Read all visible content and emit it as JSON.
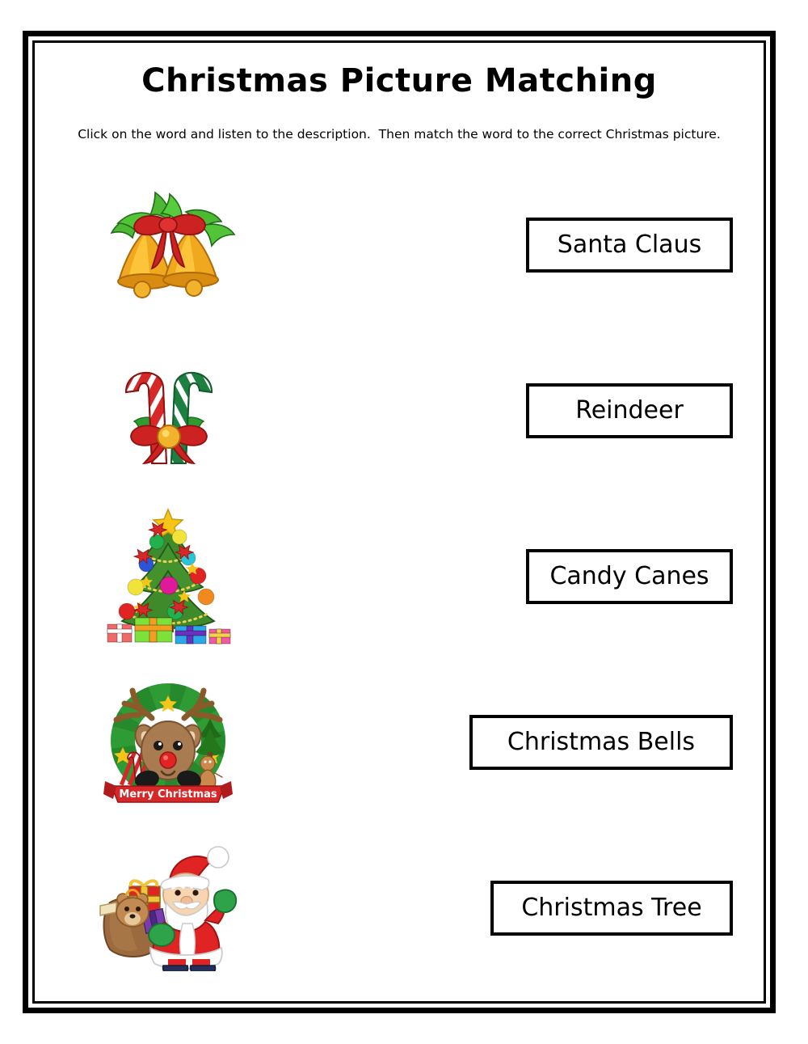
{
  "worksheet": {
    "title": "Christmas Picture Matching",
    "instructions": "Click on the word and listen to the description.  Then match the word to the correct Christmas picture."
  },
  "pictures": [
    {
      "name": "christmas-bells",
      "alt": "Two golden bells tied with a red bow and green holly leaves"
    },
    {
      "name": "candy-canes",
      "alt": "Crossed red-white and green-white candy canes with a red bow and gold bell"
    },
    {
      "name": "christmas-tree",
      "alt": "Decorated green Christmas tree with gold star, ornaments, red bows and gift boxes"
    },
    {
      "name": "reindeer-wreath",
      "alt": "Reindeer face inside a green wreath with a Merry Christmas banner"
    },
    {
      "name": "santa-claus",
      "alt": "Santa Claus with a brown gift sack holding a teddy bear"
    }
  ],
  "words": [
    {
      "label": "Santa Claus",
      "width": "narrow"
    },
    {
      "label": "Reindeer",
      "width": "narrow"
    },
    {
      "label": "Candy Canes",
      "width": "narrow"
    },
    {
      "label": "Christmas Bells",
      "width": "wide"
    },
    {
      "label": "Christmas Tree",
      "width": "mid"
    }
  ],
  "banner": {
    "text": "Merry Christmas"
  },
  "colors": {
    "border": "#000000",
    "text": "#000000",
    "page_background": "#ffffff",
    "bell_gold": "#f0a81e",
    "bell_gold_dark": "#c8780e",
    "holly_green": "#45a829",
    "ribbon_red": "#cc2222",
    "cane_red": "#d62828",
    "cane_green": "#1e8040",
    "tree_green": "#3f8a2b",
    "tree_green_dark": "#2d6b1e",
    "star_gold": "#f5c518",
    "reindeer_brown": "#a97b50",
    "antler_brown": "#8a5a2b",
    "santa_red": "#e02020",
    "santa_skin": "#f6d5b0",
    "mitten_green": "#2fa34a",
    "boot_navy": "#23305c",
    "sack_brown": "#9b6b3f"
  }
}
